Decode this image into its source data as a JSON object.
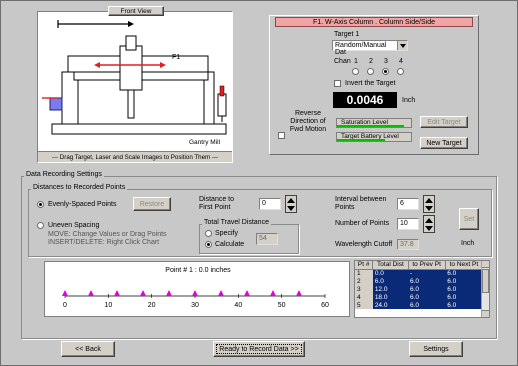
{
  "window": {
    "bg_color": "#c8c8c8"
  },
  "diagram": {
    "tab_label": "Front View",
    "f1_label": "F1",
    "machine_label": "Gantry Mill",
    "hint": "--- Drag Target, Laser and Scale Images to Position Them ---",
    "accent_red": "#e02020",
    "target_box_color": "#6060e0"
  },
  "axis_panel": {
    "title": "F1. W-Axis Column . Column Side/Side",
    "title_bg": "#f2a4a4",
    "target_label": "Target 1",
    "target_select": "Random/Manual Dat",
    "chan_label": "Chan",
    "channels": [
      "1",
      "2",
      "3",
      "4"
    ],
    "selected_channel": "3",
    "invert_label": "Invert the Target",
    "reading": "0.0046",
    "unit": "Inch",
    "reverse_label_1": "Reverse",
    "reverse_label_2": "Direction of",
    "reverse_label_3": "Fwd Motion",
    "saturation_label": "Saturation Level",
    "battery_label": "Target Battery Level",
    "saturation_level": 0.9,
    "battery_level": 0.65,
    "edit_target_button": "Edit Target",
    "new_target_button": "New Target"
  },
  "settings": {
    "group_title": "Data Recording Settings",
    "distances_title": "Distances to Recorded Points",
    "evenly_label": "Evenly-Spaced Points",
    "restore_button": "Restore",
    "uneven_label": "Uneven Spacing",
    "uneven_hint_1": "MOVE: Change Values or Drag Points",
    "uneven_hint_2": "INSERT/DELETE: Right Click Chart",
    "dist_first_label_1": "Distance to",
    "dist_first_label_2": "First Point",
    "dist_first_value": "0",
    "total_travel_title": "Total Travel Distance",
    "specify_label": "Specify",
    "calculate_label": "Calculate",
    "total_value": "54",
    "interval_label_1": "Interval between",
    "interval_label_2": "Points",
    "interval_value": "6",
    "numpoints_label": "Number of Points",
    "numpoints_value": "10",
    "set_button": "Set",
    "cutoff_label": "Wavelength Cutoff",
    "cutoff_value": "37.8",
    "inch_label": "Inch"
  },
  "chart_data": {
    "type": "scatter",
    "title": "Point # 1 :  0.0 inches",
    "x": [
      0,
      6,
      12,
      18,
      24,
      30,
      36,
      42,
      48,
      54
    ],
    "ticks": [
      0,
      10,
      20,
      30,
      40,
      50,
      60
    ],
    "xlim": [
      0,
      60
    ],
    "marker_color": "#e000e0"
  },
  "table": {
    "headers": [
      "Pt #",
      "Total Dist",
      "to Prev Pt",
      "to Next Pt"
    ],
    "rows": [
      [
        "1",
        "0.0",
        "-",
        "6.0"
      ],
      [
        "2",
        "6.0",
        "6.0",
        "6.0"
      ],
      [
        "3",
        "12.0",
        "6.0",
        "6.0"
      ],
      [
        "4",
        "18.0",
        "6.0",
        "6.0"
      ],
      [
        "5",
        "24.0",
        "6.0",
        "6.0"
      ]
    ],
    "header_bg": "#0a2a78",
    "selected_bg": "#0a2a78"
  },
  "footer": {
    "back_button": "<< Back",
    "record_button": "Ready to Record Data  >>",
    "settings_button": "Settings"
  }
}
